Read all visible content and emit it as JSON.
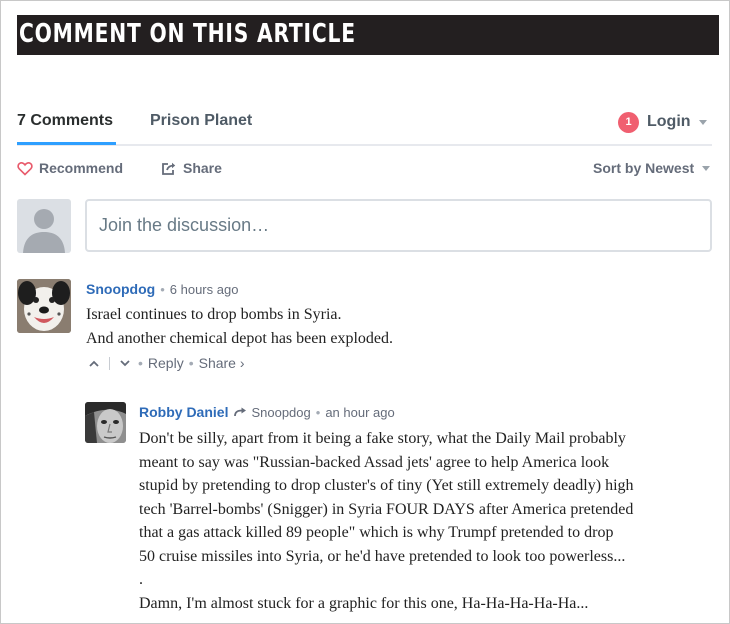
{
  "banner": {
    "title": "COMMENT ON THIS ARTICLE"
  },
  "nav": {
    "tabs": [
      {
        "label": "7 Comments",
        "active": true
      },
      {
        "label": "Prison Planet",
        "active": false
      }
    ],
    "login": {
      "badge": "1",
      "label": "Login"
    }
  },
  "actions": {
    "recommend": "Recommend",
    "share": "Share",
    "sort": "Sort by Newest"
  },
  "compose": {
    "placeholder": "Join the discussion…"
  },
  "comments": [
    {
      "author": "Snoopdog",
      "time": "6 hours ago",
      "lines": [
        "Israel continues to drop bombs in Syria.",
        "And another chemical depot has been exploded."
      ],
      "reply_label": "Reply",
      "share_label": "Share ›"
    },
    {
      "author": "Robby Daniel",
      "reply_to": "Snoopdog",
      "time": "an hour ago",
      "lines": [
        "Don't be silly, apart from it being a fake story, what the Daily Mail probably",
        "meant to say was \"Russian-backed Assad jets' agree to help America look",
        "stupid by pretending to drop cluster's of tiny (Yet still extremely deadly) high",
        "tech 'Barrel-bombs' (Snigger) in Syria FOUR DAYS after America pretended",
        "that a gas attack killed 89 people\" which is why Trumpf pretended to drop",
        "50 cruise missiles into Syria, or he'd have pretended to look too powerless...",
        ".",
        "Damn, I'm almost stuck for a graphic for this one, Ha-Ha-Ha-Ha-Ha..."
      ]
    }
  ],
  "colors": {
    "banner_bg": "#231f20",
    "tab_active_underline": "#2e9fff",
    "badge": "#f05f70",
    "author_link": "#2e6bb8",
    "recommend_heart": "#e85a6b"
  }
}
